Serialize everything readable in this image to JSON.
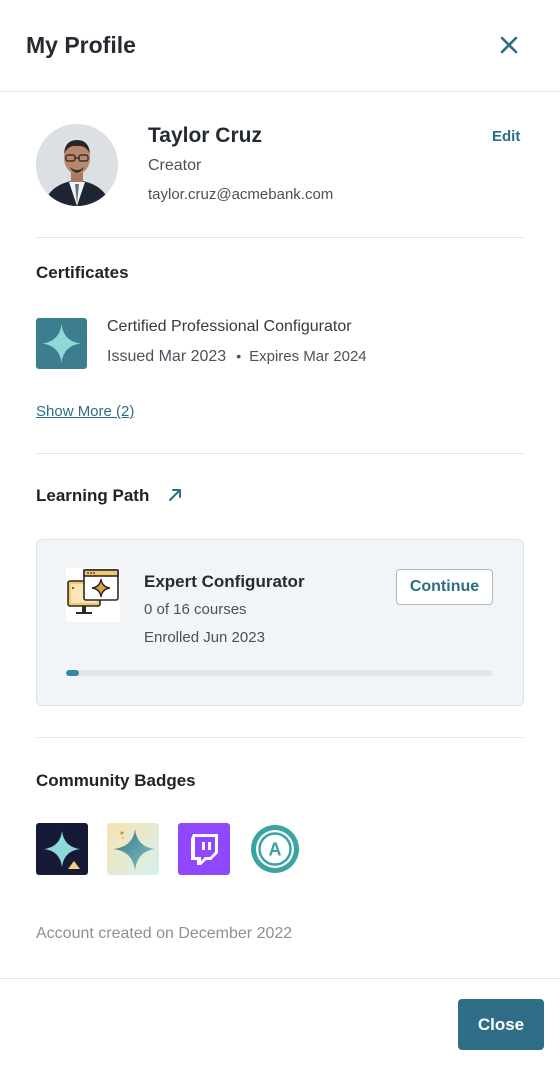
{
  "header": {
    "title": "My Profile",
    "close_icon": "close-x-icon"
  },
  "profile": {
    "name": "Taylor Cruz",
    "role": "Creator",
    "email": "taylor.cruz@acmebank.com",
    "edit_label": "Edit"
  },
  "certificates": {
    "title": "Certificates",
    "items": [
      {
        "name": "Certified Professional Configurator",
        "issued": "Issued Mar 2023",
        "expires": "Expires Mar 2024",
        "separator": "•",
        "icon": "sparkle-icon"
      }
    ],
    "show_more_label": "Show More (2)"
  },
  "learning_path": {
    "title": "Learning Path",
    "link_icon": "arrow-up-right-icon",
    "card": {
      "name": "Expert Configurator",
      "courses": "0 of 16 courses",
      "enrolled": "Enrolled Jun 2023",
      "continue_label": "Continue",
      "progress_fraction": 0.0
    }
  },
  "community_badges": {
    "title": "Community Badges",
    "badges": [
      "sparkle-dark-badge-icon",
      "sparkle-gradient-badge-icon",
      "twitch-badge-icon",
      "letter-a-badge-icon"
    ],
    "badge_letter": "A"
  },
  "account_created": "Account created on December 2022",
  "footer": {
    "close_label": "Close"
  },
  "colors": {
    "accent": "#2b6f84",
    "primary_button": "#2f6e86",
    "progress": "#2e8aa5"
  }
}
